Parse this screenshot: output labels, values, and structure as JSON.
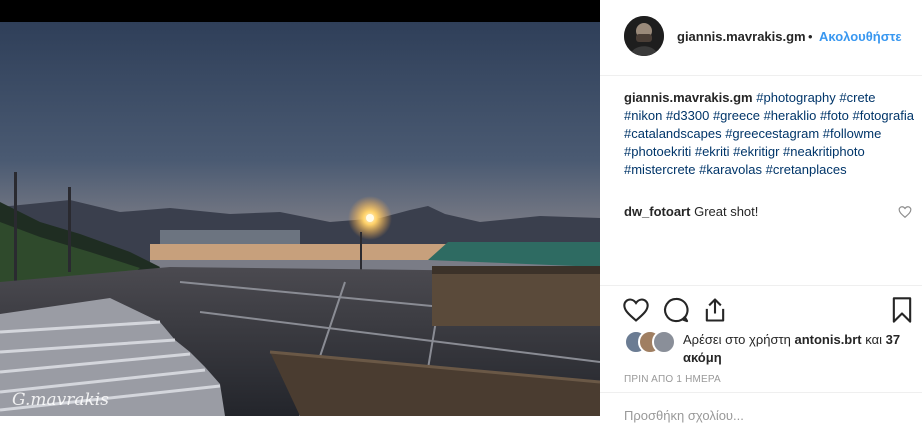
{
  "photo": {
    "watermark": "G.mavrakis",
    "alt": "Heraklion waterfront at sunset"
  },
  "header": {
    "username": "giannis.mavrakis.gm",
    "separator": "•",
    "follow_label": "Ακολουθήστε"
  },
  "caption": {
    "username": "giannis.mavrakis.gm",
    "hashtags": [
      "#photography",
      "#crete",
      "#nikon",
      "#d3300",
      "#greece",
      "#heraklio",
      "#foto",
      "#fotografia",
      "#catalandscapes",
      "#greecestagram",
      "#followme",
      "#photoekriti",
      "#ekriti",
      "#ekritigr",
      "#neakritiphoto",
      "#mistercrete",
      "#karavolas",
      "#cretanplaces"
    ]
  },
  "comments": [
    {
      "username": "dw_fotoart",
      "text": "Great shot!"
    }
  ],
  "actions": {
    "like_icon": "heart-icon",
    "comment_icon": "comment-icon",
    "share_icon": "share-icon",
    "save_icon": "bookmark-icon"
  },
  "likes": {
    "prefix": "Αρέσει στο χρήστη",
    "user": "antonis.brt",
    "suffix": "και",
    "others": "37 ακόμη"
  },
  "timestamp": "ΠΡΙΝ ΑΠΟ 1 ΗΜΕΡΑ",
  "add_comment_placeholder": "Προσθήκη σχολίου...",
  "colors": {
    "accent": "#3897f0",
    "hashtag": "#003569",
    "text": "#262626",
    "muted": "#999999",
    "divider": "#efefef"
  }
}
